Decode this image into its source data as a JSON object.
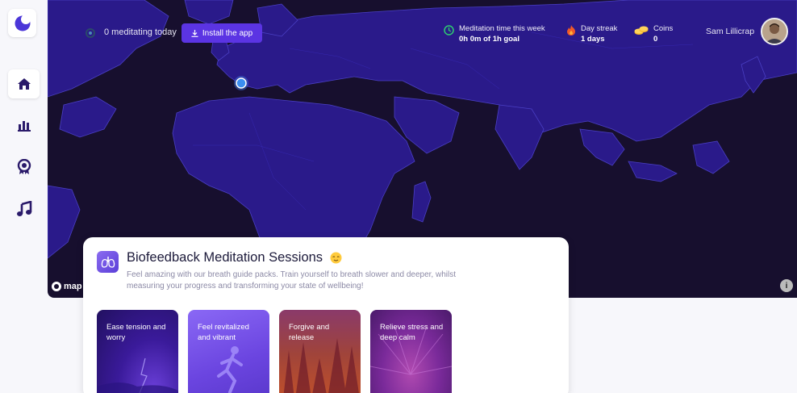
{
  "sidebar": {
    "items": [
      {
        "name": "home",
        "active": true
      },
      {
        "name": "stats",
        "active": false
      },
      {
        "name": "achievements",
        "active": false
      },
      {
        "name": "music",
        "active": false
      }
    ]
  },
  "topbar": {
    "meditating_count": "0 meditating today",
    "install_label": "Install the app",
    "stats": [
      {
        "label": "Meditation time this week",
        "value": "0h 0m of 1h goal"
      },
      {
        "label": "Day streak",
        "value": "1 days"
      },
      {
        "label": "Coins",
        "value": "0"
      }
    ],
    "user_name": "Sam Lillicrap"
  },
  "map": {
    "attribution_logo": "map"
  },
  "sessions": {
    "title": "Biofeedback Meditation Sessions",
    "description": "Feel amazing with our breath guide packs. Train yourself to breath slower and deeper, whilst measuring your progress and transforming your state of wellbeing!",
    "tiles": [
      {
        "label": "Ease tension and worry"
      },
      {
        "label": "Feel revitalized and vibrant"
      },
      {
        "label": "Forgive and release"
      },
      {
        "label": "Relieve stress and deep calm"
      }
    ]
  },
  "colors": {
    "accent": "#5b34e3",
    "map_bg": "#170f2e",
    "land": "#2a1a8a",
    "land_border": "#4a3fc4"
  }
}
